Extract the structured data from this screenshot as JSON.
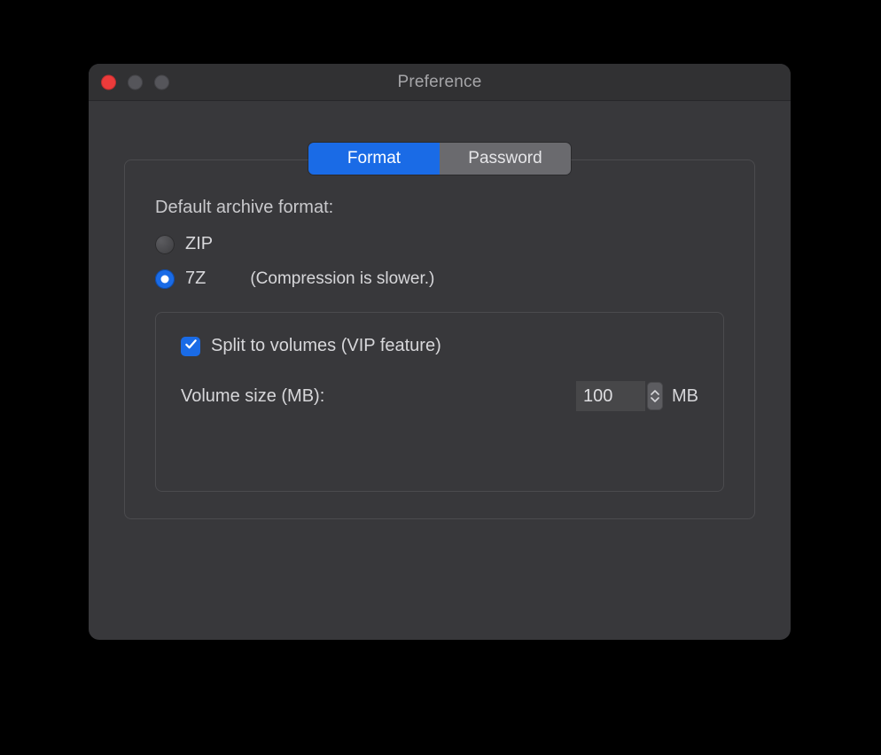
{
  "window": {
    "title": "Preference"
  },
  "tabs": {
    "format": "Format",
    "password": "Password",
    "active": "format"
  },
  "format": {
    "heading": "Default archive format:",
    "options": {
      "zip": "ZIP",
      "sevenz": "7Z",
      "selected": "sevenz",
      "sevenz_note": "(Compression is slower.)"
    },
    "split": {
      "checkbox_label": "Split to volumes (VIP feature)",
      "checked": true,
      "volume_label": "Volume size (MB):",
      "volume_value": "100",
      "volume_unit": "MB"
    }
  }
}
